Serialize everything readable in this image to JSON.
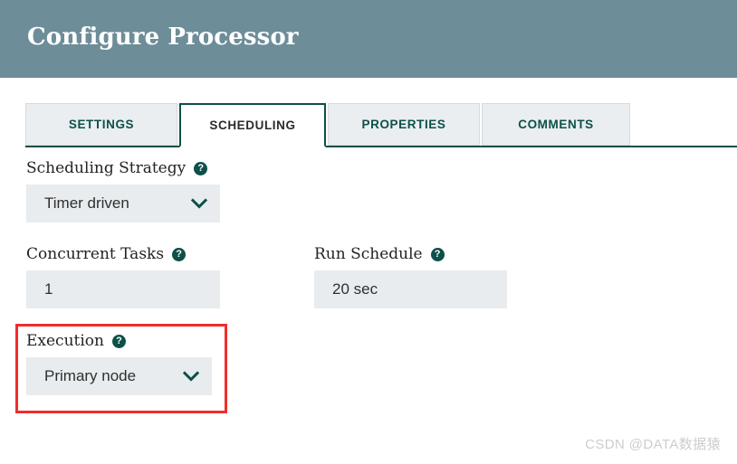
{
  "header": {
    "title": "Configure Processor",
    "background_color": "#6d8d99",
    "title_color": "#ffffff"
  },
  "theme": {
    "accent_color": "#0d5049",
    "control_background": "#e8ecef",
    "tab_inactive_background": "#eaeef0",
    "annotation_color": "#f12d2d"
  },
  "tabs": {
    "active_index": 1,
    "items": [
      {
        "label": "SETTINGS"
      },
      {
        "label": "SCHEDULING"
      },
      {
        "label": "PROPERTIES"
      },
      {
        "label": "COMMENTS"
      }
    ]
  },
  "form": {
    "scheduling_strategy": {
      "label": "Scheduling Strategy",
      "help_icon": "help-circle-icon",
      "help_glyph": "?",
      "value": "Timer driven",
      "type": "dropdown"
    },
    "concurrent_tasks": {
      "label": "Concurrent Tasks",
      "help_icon": "help-circle-icon",
      "help_glyph": "?",
      "value": "1",
      "type": "text"
    },
    "run_schedule": {
      "label": "Run Schedule",
      "help_icon": "help-circle-icon",
      "help_glyph": "?",
      "value": "20 sec",
      "type": "text"
    },
    "execution": {
      "label": "Execution",
      "help_icon": "help-circle-icon",
      "help_glyph": "?",
      "value": "Primary node",
      "type": "dropdown",
      "highlighted": true
    }
  },
  "watermark": {
    "text": "CSDN @DATA数据猿"
  }
}
